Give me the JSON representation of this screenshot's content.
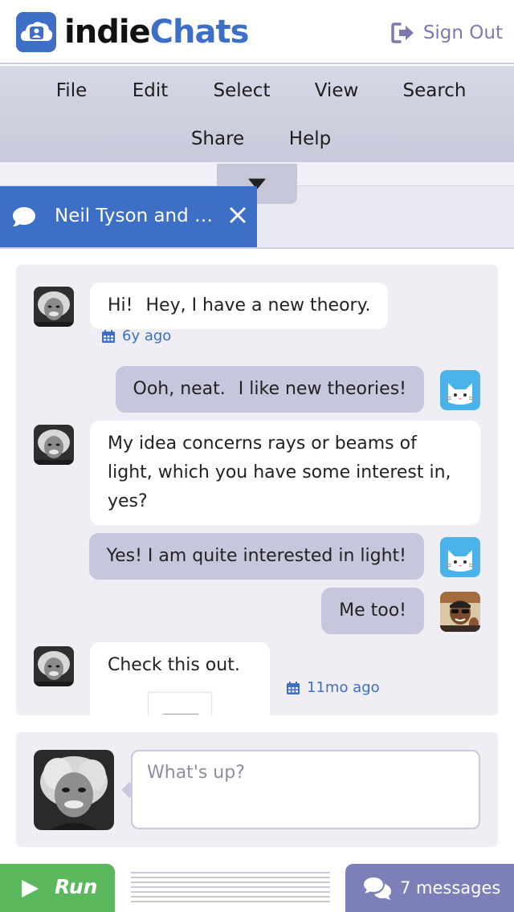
{
  "app": {
    "logo_part1": "indie",
    "logo_part2": "Chats",
    "sign_out_label": "Sign Out"
  },
  "menu": {
    "items": [
      "File",
      "Edit",
      "Select",
      "View",
      "Search",
      "Share",
      "Help"
    ]
  },
  "tab": {
    "label": "Neil Tyson and …"
  },
  "messages": [
    {
      "from": "einstein",
      "side": "in",
      "parts": [
        "Hi!",
        "Hey, I have a new theory."
      ]
    },
    {
      "timestamp": "6y ago"
    },
    {
      "from": "cat",
      "side": "out",
      "parts": [
        "Ooh, neat.",
        "I like new theories!"
      ]
    },
    {
      "from": "einstein",
      "side": "in",
      "lines": [
        "My idea concerns rays or beams of",
        "light, which you have some interest in,",
        "yes?"
      ]
    },
    {
      "from": "cat",
      "side": "out",
      "text": "Yes!  I am quite interested in light!"
    },
    {
      "from": "neil",
      "side": "out",
      "text": "Me too!"
    },
    {
      "from": "einstein",
      "side": "in",
      "text": "Check this out."
    },
    {
      "timestamp": "11mo ago"
    }
  ],
  "composer": {
    "placeholder": "What's up?"
  },
  "bottom": {
    "run_label": "Run",
    "messages_label": "7 messages"
  },
  "colors": {
    "brand": "#3d6fc6",
    "run": "#5cb85c",
    "messages": "#7c7fb8",
    "sign_out": "#7c78b0"
  }
}
